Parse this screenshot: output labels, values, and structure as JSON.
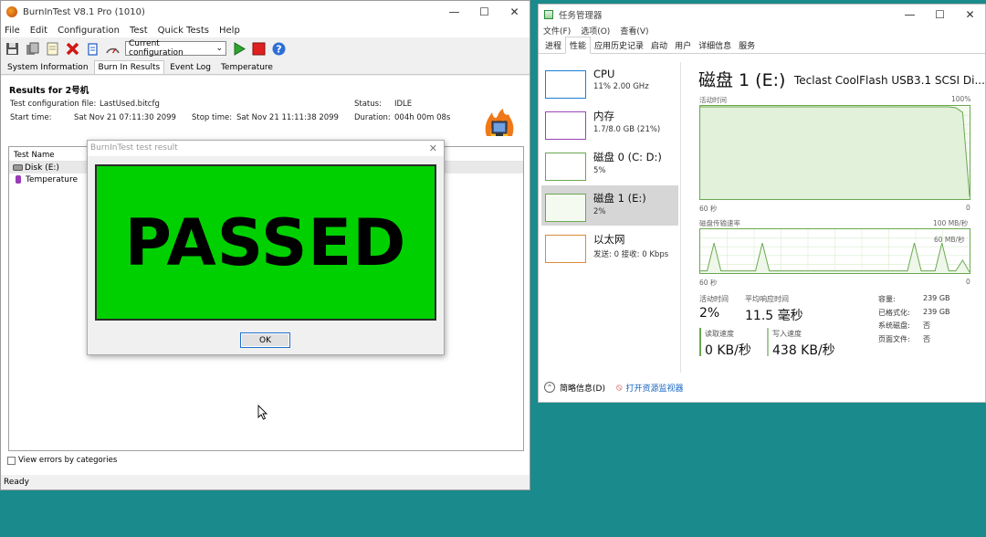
{
  "bit": {
    "title": "BurnInTest V8.1 Pro (1010)",
    "menu": [
      "File",
      "Edit",
      "Configuration",
      "Test",
      "Quick Tests",
      "Help"
    ],
    "config_select": "Current configuration",
    "tabs": [
      "System Information",
      "Burn In Results",
      "Event Log",
      "Temperature"
    ],
    "results_title": "Results for 2号机",
    "config_file_label": "Test configuration file:",
    "config_file_value": "LastUsed.bitcfg",
    "start_label": "Start time:",
    "start_value": "Sat Nov 21 07:11:30 2099",
    "stop_label": "Stop time:",
    "stop_value": "Sat Nov 21 11:11:38 2099",
    "status_label": "Status:",
    "status_value": "IDLE",
    "duration_label": "Duration:",
    "duration_value": "004h 00m 08s",
    "list_header": "Test Name",
    "rows": [
      "Disk (E:)",
      "Temperature"
    ],
    "view_errors": "View errors by categories",
    "status_bar": "Ready",
    "dialog": {
      "title": "BurnInTest test result",
      "result": "PASSED",
      "ok": "OK"
    },
    "colors": {
      "passed_bg": "#00d000"
    }
  },
  "tm": {
    "title": "任务管理器",
    "menu": [
      "文件(F)",
      "选项(O)",
      "查看(V)"
    ],
    "tabs": [
      "进程",
      "性能",
      "应用历史记录",
      "启动",
      "用户",
      "详细信息",
      "服务"
    ],
    "side": [
      {
        "name": "CPU",
        "sub": "11% 2.00 GHz"
      },
      {
        "name": "内存",
        "sub": "1.7/8.0 GB (21%)"
      },
      {
        "name": "磁盘 0 (C: D:)",
        "sub": "5%"
      },
      {
        "name": "磁盘 1 (E:)",
        "sub": "2%"
      },
      {
        "name": "以太网",
        "sub": "发送: 0 接收: 0 Kbps"
      }
    ],
    "disk_title": "磁盘 1 (E:)",
    "disk_model": "Teclast CoolFlash USB3.1 SCSI Di...",
    "g1_label": "活动时间",
    "g1_max": "100%",
    "g1_time": "60 秒",
    "g1_min": "0",
    "g2_label": "磁盘传输速率",
    "g2_max": "100 MB/秒",
    "g2_mid": "60 MB/秒",
    "g2_time": "60 秒",
    "g2_min": "0",
    "active_label": "活动时间",
    "active_value": "2%",
    "resp_label": "平均响应时间",
    "resp_value": "11.5 毫秒",
    "read_label": "读取速度",
    "read_value": "0 KB/秒",
    "write_label": "写入速度",
    "write_value": "438 KB/秒",
    "cap_label": "容量:",
    "cap_value": "239 GB",
    "fmt_label": "已格式化:",
    "fmt_value": "239 GB",
    "sys_label": "系统磁盘:",
    "sys_value": "否",
    "page_label": "页面文件:",
    "page_value": "否",
    "footer_less": "简略信息(D)",
    "footer_monitor": "打开资源监视器",
    "g1_series": [
      1,
      1,
      1,
      1,
      1,
      1,
      1,
      1,
      1,
      1,
      1,
      1,
      1,
      1,
      1,
      1,
      1,
      1,
      1,
      1,
      1,
      1,
      1,
      1,
      1,
      1,
      1,
      1,
      1,
      1,
      1,
      1,
      1,
      1,
      1,
      1,
      1,
      0.99,
      0.94,
      0.03
    ],
    "g2_series": [
      0.05,
      0.05,
      0.7,
      0.05,
      0.05,
      0.05,
      0.05,
      0.05,
      0.05,
      0.7,
      0.05,
      0.05,
      0.05,
      0.05,
      0.05,
      0.05,
      0.05,
      0.05,
      0.05,
      0.05,
      0.05,
      0.05,
      0.05,
      0.05,
      0.05,
      0.05,
      0.05,
      0.05,
      0.05,
      0.05,
      0.05,
      0.7,
      0.05,
      0.05,
      0.05,
      0.7,
      0.05,
      0.05,
      0.3,
      0.02
    ],
    "colors": {
      "disk": "#6aa84f",
      "cpu": "#1a7fd4",
      "mem": "#9b44b8",
      "eth": "#d98b3a"
    }
  }
}
